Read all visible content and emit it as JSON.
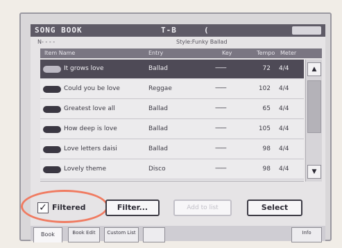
{
  "window": {
    "title": "SONG BOOK",
    "mode": "T-B",
    "bracket": "("
  },
  "info": {
    "number": "N- - - -",
    "style": "Style:Funky Ballad"
  },
  "columns": [
    "Item Name",
    "Entry",
    "Key",
    "Tempo",
    "Meter"
  ],
  "rows": [
    {
      "icon": "style-icon",
      "name": "It grows love",
      "style": "Ballad",
      "key": "-------",
      "tempo": "72",
      "meter": "4/4"
    },
    {
      "icon": "style-icon",
      "name": "Could you be love",
      "style": "Reggae",
      "key": "-------",
      "tempo": "102",
      "meter": "4/4"
    },
    {
      "icon": "style-icon",
      "name": "Greatest love all",
      "style": "Ballad",
      "key": "-------",
      "tempo": "65",
      "meter": "4/4"
    },
    {
      "icon": "style-icon",
      "name": "How deep is love",
      "style": "Ballad",
      "key": "-------",
      "tempo": "105",
      "meter": "4/4"
    },
    {
      "icon": "style-icon",
      "name": "Love letters daisi",
      "style": "Ballad",
      "key": "-------",
      "tempo": "98",
      "meter": "4/4"
    },
    {
      "icon": "style-icon",
      "name": "Lovely theme",
      "style": "Disco",
      "key": "-------",
      "tempo": "98",
      "meter": "4/4"
    }
  ],
  "controls": {
    "filtered_label": "Filtered",
    "filtered_checked": true,
    "filter_button": "Filter...",
    "add_to_list_button": "Add to list",
    "select_button": "Select"
  },
  "tabs": [
    {
      "label": "Book",
      "active": true
    },
    {
      "label": "Book Edit",
      "active": false
    },
    {
      "label": "Custom List",
      "active": false
    },
    {
      "label": "",
      "active": false
    },
    {
      "label": "Info",
      "active": false
    }
  ],
  "scroll": {
    "up_arrow": "▲",
    "down_arrow": "▼"
  },
  "colors": {
    "titlebar": "#5e5a66",
    "selected_row": "#4e4a56",
    "highlight_ring": "#f07b61"
  }
}
